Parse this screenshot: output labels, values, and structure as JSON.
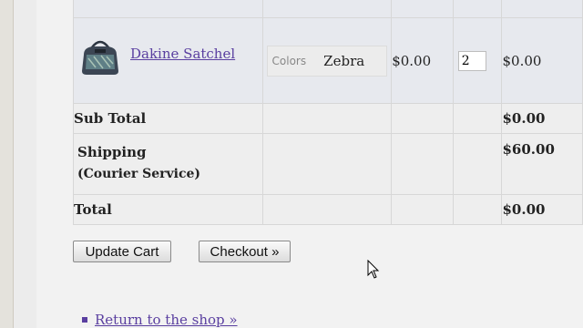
{
  "cart": {
    "item": {
      "name": "Dakine Satchel",
      "option_label": "Colors",
      "option_value": "Zebra",
      "unit_price": "$0.00",
      "quantity": "2",
      "line_total": "$0.00"
    },
    "subtotal": {
      "label": "Sub Total",
      "value": "$0.00"
    },
    "shipping": {
      "label": "Shipping",
      "method": "(Courier Service)",
      "value": "$60.00"
    },
    "total": {
      "label": "Total",
      "value": "$0.00"
    }
  },
  "actions": {
    "update_label": "Update Cart",
    "checkout_label": "Checkout »"
  },
  "links": {
    "return_label": "Return to the shop »"
  },
  "colors": {
    "link": "#5a3fa0",
    "table_bg": "#e7e9ee"
  },
  "icons": [
    "product-bag-image",
    "mouse-cursor-icon"
  ]
}
